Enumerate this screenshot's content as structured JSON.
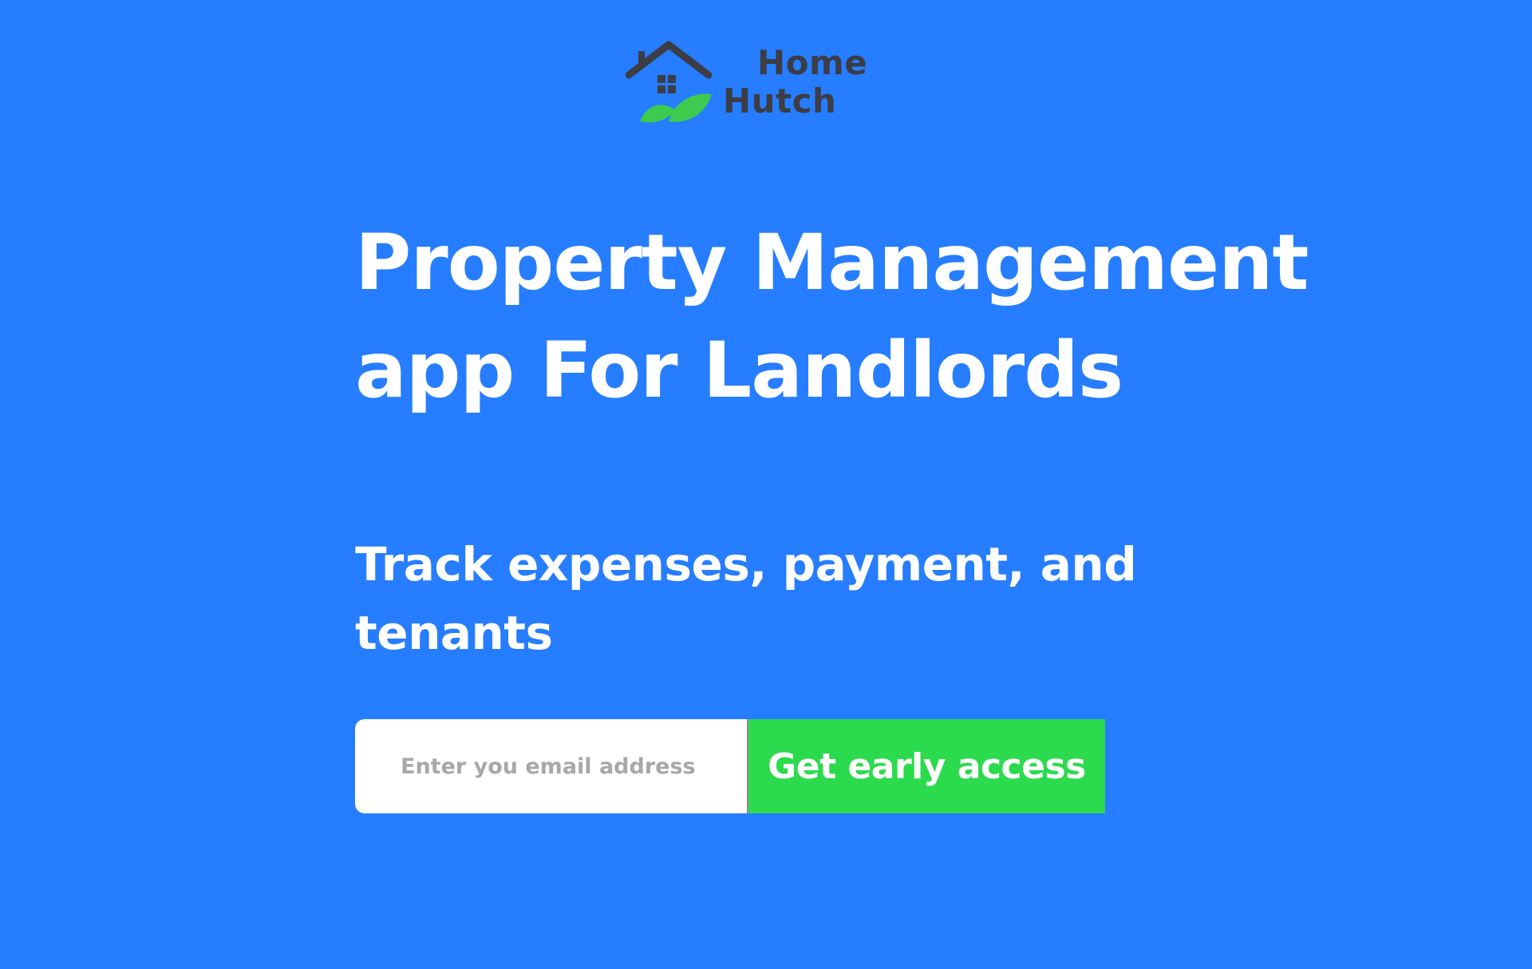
{
  "brand": {
    "logo_line1": "Home",
    "logo_line2": "Hutch",
    "logo_icon": "house-with-leaves-icon",
    "text_color": "#3C3D45",
    "leaf_color": "#3DCB4F"
  },
  "hero": {
    "headline": "Property Management app For Landlords",
    "subheadline": "Track expenses, payment, and tenants"
  },
  "signup": {
    "email_placeholder": "Enter you email address",
    "email_value": "",
    "button_label": "Get early access"
  },
  "colors": {
    "background": "#267DFF",
    "button": "#2CDB4D",
    "text": "#FFFFFF"
  }
}
